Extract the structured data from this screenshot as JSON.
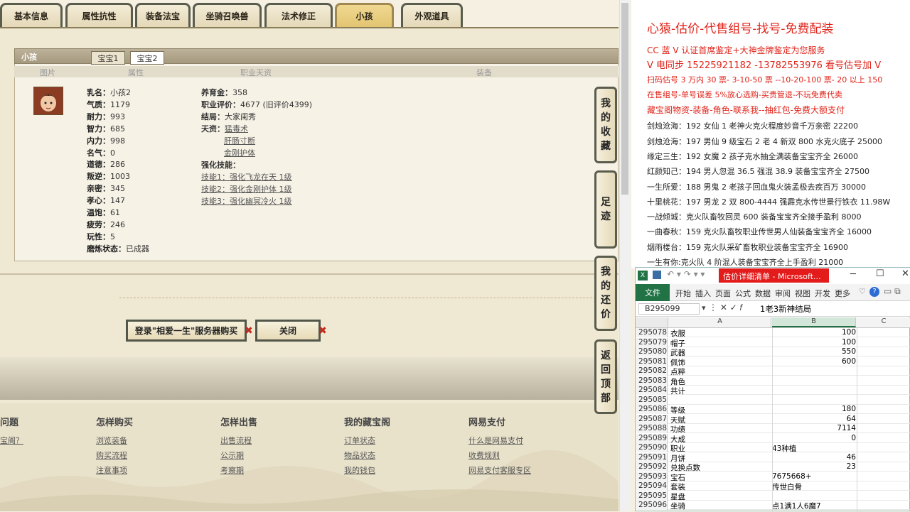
{
  "tabs": [
    "基本信息",
    "属性抗性",
    "装备法宝",
    "坐骑召唤兽",
    "法术修正",
    "小孩",
    "外观道具"
  ],
  "active_tab": "小孩",
  "panel": {
    "title": "小孩",
    "subtabs": [
      "宝宝1",
      "宝宝2"
    ],
    "columns": [
      "图片",
      "属性",
      "职业天资",
      "装备"
    ]
  },
  "attributes": [
    {
      "k": "乳名：",
      "v": "小孩2"
    },
    {
      "k": "气质：",
      "v": "1179"
    },
    {
      "k": "耐力：",
      "v": "993"
    },
    {
      "k": "智力：",
      "v": "685"
    },
    {
      "k": "内力：",
      "v": "998"
    },
    {
      "k": "名气：",
      "v": "0"
    },
    {
      "k": "道德：",
      "v": "286"
    },
    {
      "k": "叛逆：",
      "v": "1003"
    },
    {
      "k": "亲密：",
      "v": "345"
    },
    {
      "k": "孝心：",
      "v": "147"
    },
    {
      "k": "温饱：",
      "v": "61"
    },
    {
      "k": "疲劳：",
      "v": "246"
    },
    {
      "k": "玩性：",
      "v": "5"
    },
    {
      "k": "磨炼状态：",
      "v": "已成器"
    }
  ],
  "career": {
    "yangyu_label": "养育金：",
    "yangyu": "358",
    "pingjia_label": "职业评价：",
    "pingjia": "4677 (旧评价4399)",
    "jieju_label": "结局：",
    "jieju": "大家闺秀",
    "tianzi_label": "天资：",
    "tianzi": [
      "猛毒术",
      "肝肠寸断",
      "金刚护体"
    ],
    "skills_label": "强化技能：",
    "skills": [
      "技能1：强化飞龙在天 1级",
      "技能2：强化金刚护体 1级",
      "技能3：强化幽冥冷火 1级"
    ]
  },
  "buttons": {
    "login": "登录\"相爱一生\"服务器购买",
    "close": "关闭"
  },
  "footer": {
    "cols": [
      {
        "title": "问题",
        "links": [
          "宝阁？",
          "",
          " "
        ]
      },
      {
        "title": "怎样购买",
        "links": [
          "浏览装备",
          "购买流程",
          "注意事项"
        ]
      },
      {
        "title": "怎样出售",
        "links": [
          "出售流程",
          "公示期",
          "考察期"
        ]
      },
      {
        "title": "我的藏宝阁",
        "links": [
          "订单状态",
          "物品状态",
          "我的钱包"
        ]
      },
      {
        "title": "网易支付",
        "links": [
          "什么是网易支付",
          "收费规则",
          "网易支付客服专区"
        ]
      }
    ]
  },
  "side": [
    "我的收藏",
    "足迹",
    "我的还价",
    "返回顶部"
  ],
  "ad": {
    "lines": [
      {
        "t": "心猿-估价-代售组号-找号-免费配装",
        "c": "#e0241b",
        "s": "17px"
      },
      {
        "t": "CC 蓝 V 认证首席鉴定+大神金牌鉴定为您服务",
        "c": "#e0241b",
        "s": "12px"
      },
      {
        "t": "V 电同步 15225921182 -13782553976 看号估号加 V",
        "c": "#e0241b",
        "s": "13px"
      },
      {
        "t": "扫码估号 3 万内 30 票- 3-10-50 票 --10-20-100 票- 20 以上 150",
        "c": "#e0241b",
        "s": "11px"
      },
      {
        "t": "在售组号-单号误差 5%放心选购-买贵管退-不玩免费代卖",
        "c": "#e0241b",
        "s": "11px"
      },
      {
        "t": "藏宝阁物资-装备-角色-联系我--抽红包-免费大额支付",
        "c": "#e0241b",
        "s": "12px"
      },
      {
        "t": "剑烛沧海：192 女仙 1 老神火克火程度妙音千万亲密 22200",
        "c": "#222",
        "s": "11px"
      },
      {
        "t": "剑烛沧海：197 男仙 9 级宝石 2 老 4 新双 800 水克火底子 25000",
        "c": "#222",
        "s": "11px"
      },
      {
        "t": "缘定三生：192 女魔 2 孩子克水抽全满装备宝宝齐全 26000",
        "c": "#222",
        "s": "11px"
      },
      {
        "t": "红颜知己：194 男人忽混 36.5 强混 38.9 装备宝宝齐全 27500",
        "c": "#222",
        "s": "11px"
      },
      {
        "t": "一生所爱：188 男鬼 2 老孩子回血鬼火装孟极去疾百万 30000",
        "c": "#222",
        "s": "11px"
      },
      {
        "t": "十里桃花：197 男龙 2 双 800-4444 强霹克水传世景行铁衣 11.98W",
        "c": "#222",
        "s": "11px"
      },
      {
        "t": "一战倾城：克火队畜牧回灵 600 装备宝宝齐全接手盈利 8000",
        "c": "#222",
        "s": "11px"
      },
      {
        "t": "一曲春秋：159 克火队畜牧职业传世男人仙装备宝宝齐全 16000",
        "c": "#222",
        "s": "11px"
      },
      {
        "t": "烟雨楼台：159 克火队采矿畜牧职业装备宝宝齐全 16900",
        "c": "#222",
        "s": "11px"
      },
      {
        "t": "一生有你:克火队 4 阶混人装备宝宝齐全上手盈利 21000",
        "c": "#222",
        "s": "11px"
      }
    ]
  },
  "excel": {
    "title": "估价详细清单 - Microsoft...",
    "file": "文件",
    "ribbon": [
      "开始",
      "插入",
      "页面",
      "公式",
      "数据",
      "审阅",
      "视图",
      "开发",
      "更多"
    ],
    "namebox": "B295099",
    "formula": "1老3新神结局",
    "cols": [
      "A",
      "B",
      "C"
    ],
    "rows": [
      {
        "n": "295078",
        "a": "衣服",
        "b": "100",
        "num": true
      },
      {
        "n": "295079",
        "a": "帽子",
        "b": "100",
        "num": true
      },
      {
        "n": "295080",
        "a": "武器",
        "b": "550",
        "num": true
      },
      {
        "n": "295081",
        "a": "佩饰",
        "b": "600",
        "num": true
      },
      {
        "n": "295082",
        "a": "点粹",
        "b": "",
        "num": false
      },
      {
        "n": "295083",
        "a": "角色",
        "b": "",
        "num": false
      },
      {
        "n": "295084",
        "a": "共计",
        "b": "",
        "num": false
      },
      {
        "n": "295085",
        "a": "",
        "b": "",
        "num": false
      },
      {
        "n": "295086",
        "a": "等级",
        "b": "180",
        "num": true
      },
      {
        "n": "295087",
        "a": "天赋",
        "b": "64",
        "num": true
      },
      {
        "n": "295088",
        "a": "功绩",
        "b": "7114",
        "num": true
      },
      {
        "n": "295089",
        "a": "大成",
        "b": "0",
        "num": true
      },
      {
        "n": "295090",
        "a": "职业",
        "b": "43种植",
        "num": false
      },
      {
        "n": "295091",
        "a": "月饼",
        "b": "46",
        "num": true
      },
      {
        "n": "295092",
        "a": "兑换点数",
        "b": "23",
        "num": true
      },
      {
        "n": "295093",
        "a": "宝石",
        "b": "7675668+",
        "num": false
      },
      {
        "n": "295094",
        "a": "套装",
        "b": "传世白骨",
        "num": false
      },
      {
        "n": "295095",
        "a": "星盘",
        "b": "",
        "num": false
      },
      {
        "n": "295096",
        "a": "坐骑",
        "b": "点1满1人6魔7",
        "num": false
      }
    ]
  }
}
